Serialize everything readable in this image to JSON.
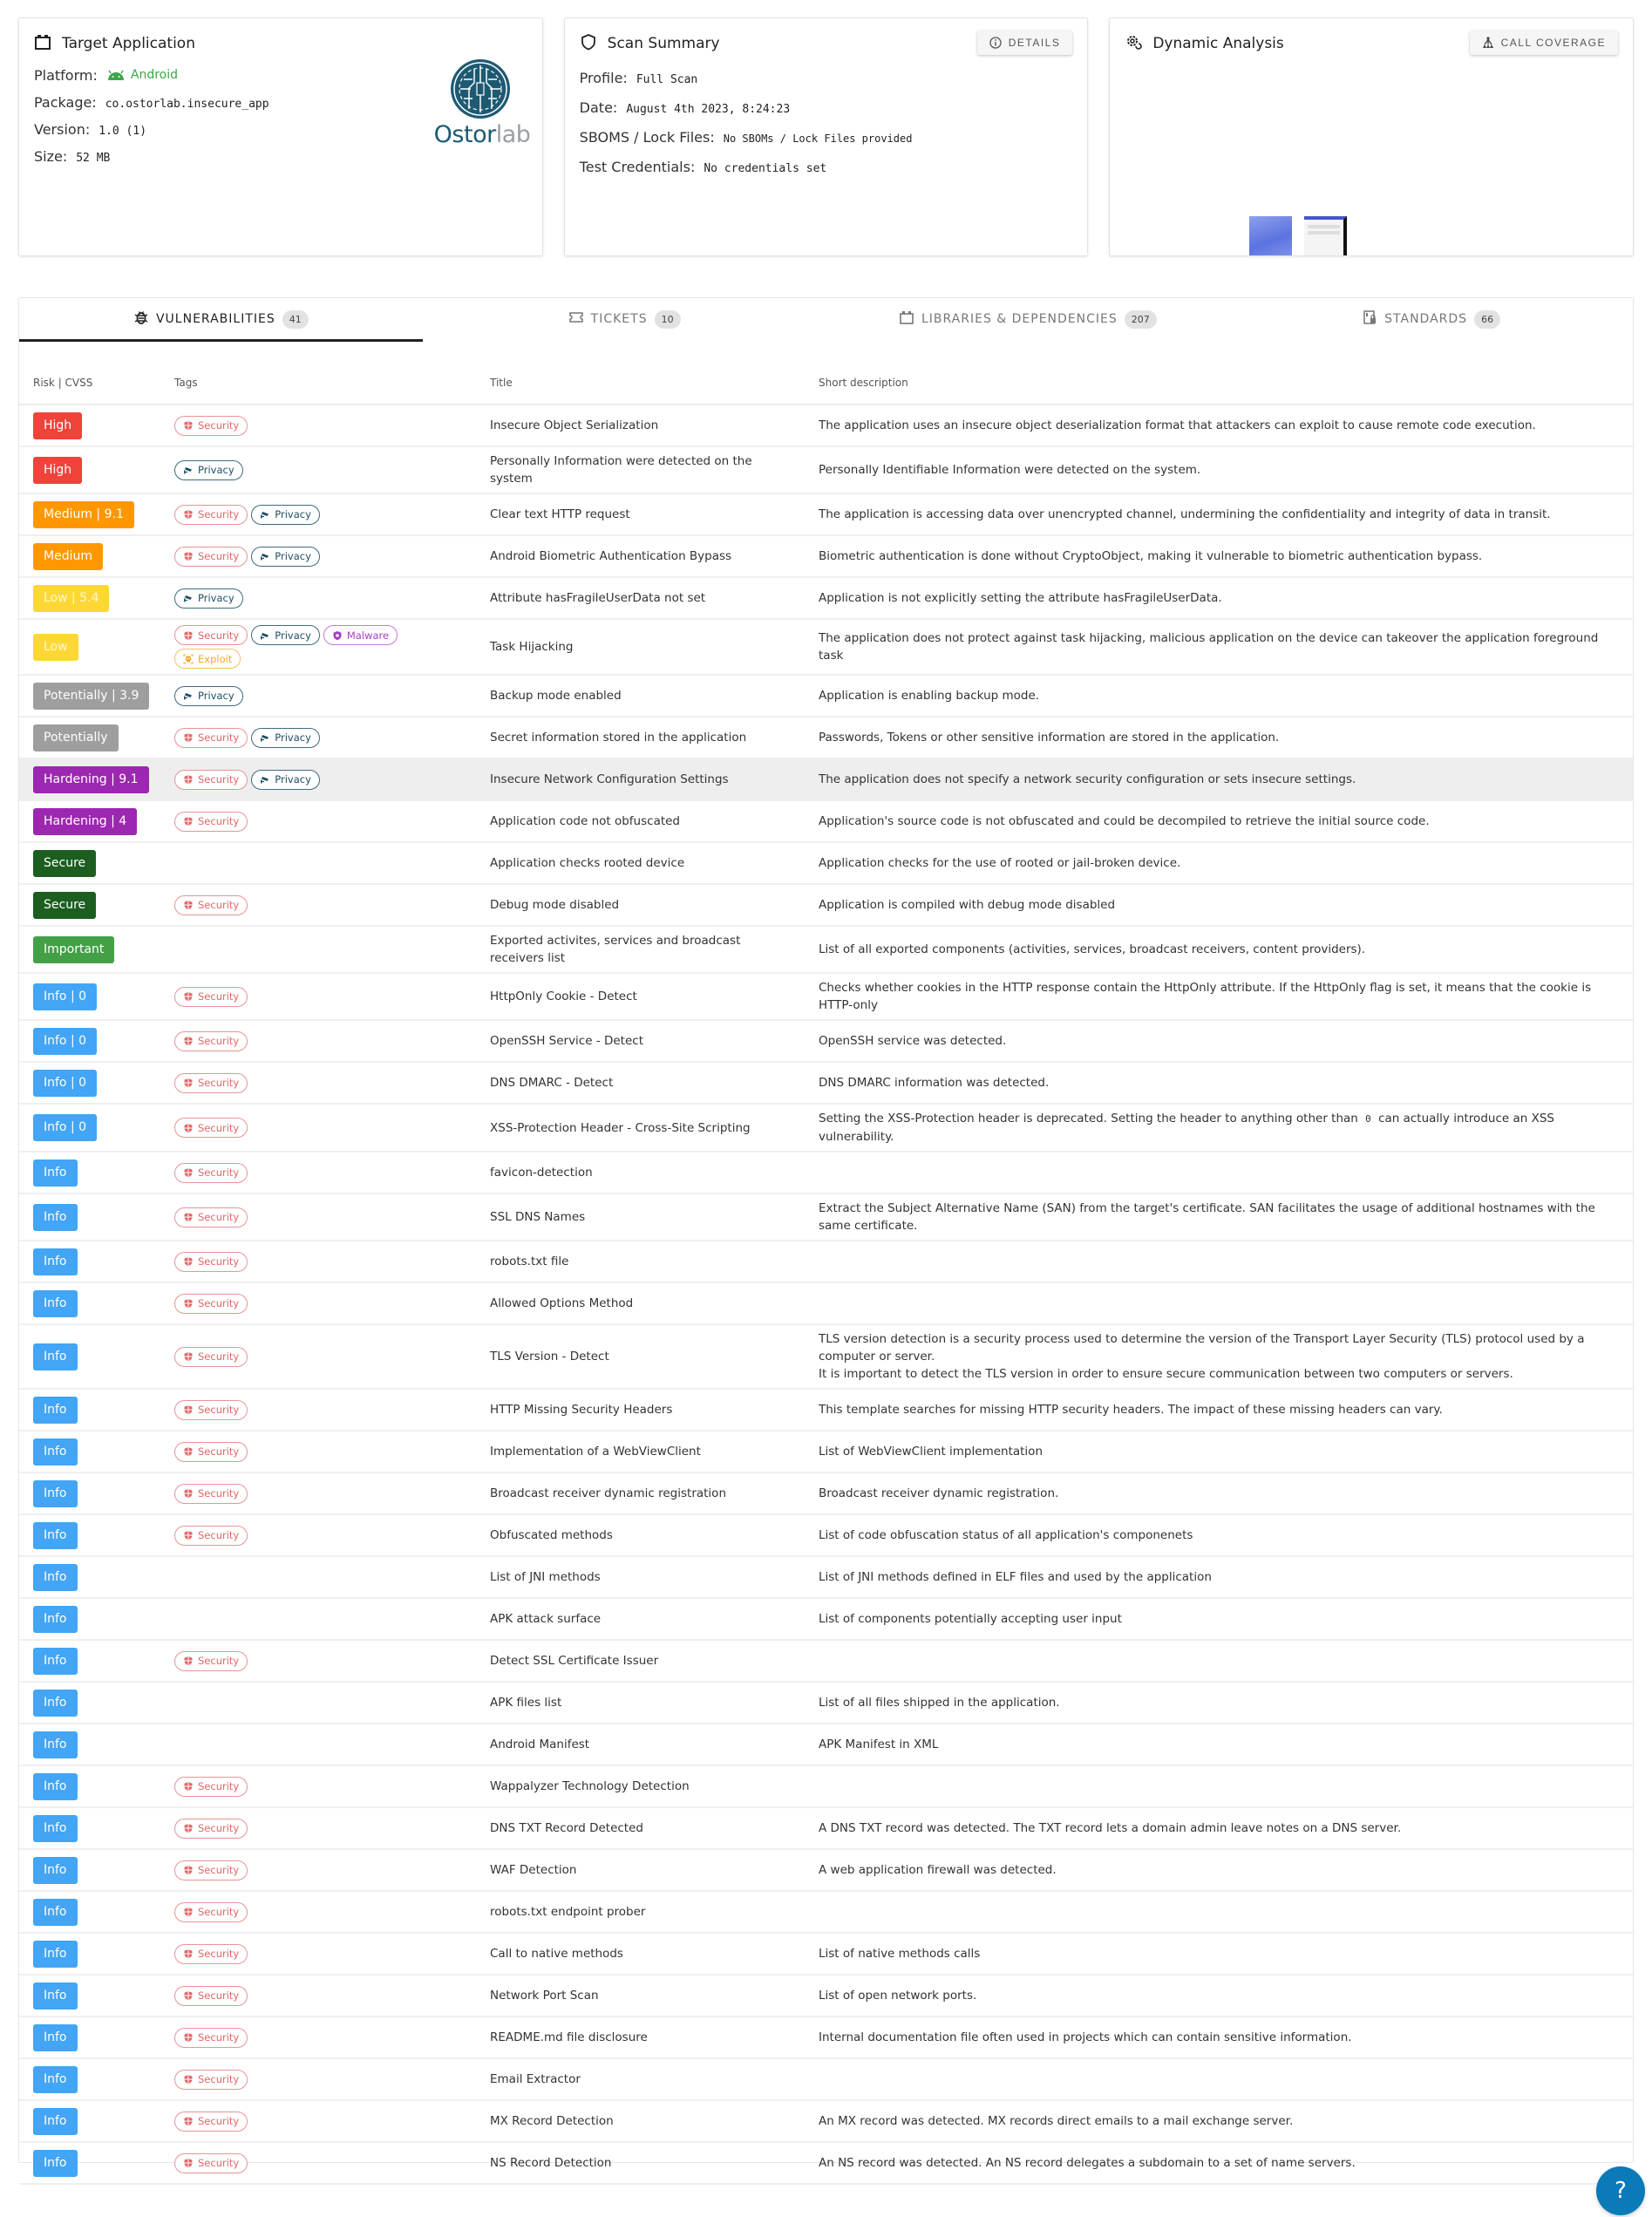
{
  "target_app": {
    "title": "Target Application",
    "platform_label": "Platform:",
    "platform_value": "Android",
    "package_label": "Package:",
    "package_value": "co.ostorlab.insecure_app",
    "version_label": "Version:",
    "version_value": "1.0 (1)",
    "size_label": "Size:",
    "size_value": "52 MB",
    "logo_text_main": "Ostor",
    "logo_text_light": "lab"
  },
  "scan_summary": {
    "title": "Scan Summary",
    "details_button": "DETAILS",
    "profile_label": "Profile:",
    "profile_value": "Full Scan",
    "date_label": "Date:",
    "date_value": "August 4th 2023, 8:24:23",
    "sboms_label": "SBOMS / Lock Files:",
    "sboms_value": "No SBOMs / Lock Files provided",
    "credentials_label": "Test Credentials:",
    "credentials_value": "No credentials set"
  },
  "dynamic_analysis": {
    "title": "Dynamic Analysis",
    "call_coverage_button": "CALL COVERAGE"
  },
  "tabs": [
    {
      "label": "VULNERABILITIES",
      "count": "41",
      "icon": "bug-icon",
      "active": true
    },
    {
      "label": "TICKETS",
      "count": "10",
      "icon": "ticket-icon",
      "active": false
    },
    {
      "label": "LIBRARIES & DEPENDENCIES",
      "count": "207",
      "icon": "package-icon",
      "active": false
    },
    {
      "label": "STANDARDS",
      "count": "66",
      "icon": "standards-lock-icon",
      "active": false
    }
  ],
  "table": {
    "headers": [
      "Risk | CVSS",
      "Tags",
      "Title",
      "Short description"
    ],
    "risk_colors": {
      "High": "#f0433a",
      "Medium": "#ff9800",
      "Low": "#fdd835",
      "Potentially": "#9e9e9e",
      "Hardening": "#9c27b0",
      "Secure": "#1b5e20",
      "Important": "#43a047",
      "Info": "#42a5f5"
    },
    "rows": [
      {
        "risk": "High",
        "cvss": "",
        "tags": [
          "Security"
        ],
        "title": "Insecure Object Serialization",
        "desc": "The application uses an insecure object deserialization format that attackers can exploit to cause remote code execution."
      },
      {
        "risk": "High",
        "cvss": "",
        "tags": [
          "Privacy"
        ],
        "title": "Personally Information were detected on the system",
        "desc": "Personally Identifiable Information were detected on the system."
      },
      {
        "risk": "Medium",
        "cvss": "9.1",
        "tags": [
          "Security",
          "Privacy"
        ],
        "title": "Clear text HTTP request",
        "desc": "The application is accessing data over unencrypted channel, undermining the confidentiality and integrity of data in transit."
      },
      {
        "risk": "Medium",
        "cvss": "",
        "tags": [
          "Security",
          "Privacy"
        ],
        "title": "Android Biometric Authentication Bypass",
        "desc": "Biometric authentication is done without CryptoObject, making it vulnerable to biometric authentication bypass."
      },
      {
        "risk": "Low",
        "cvss": "5.4",
        "tags": [
          "Privacy"
        ],
        "title": "Attribute hasFragileUserData not set",
        "desc": "Application is not explicitly setting the attribute hasFragileUserData."
      },
      {
        "risk": "Low",
        "cvss": "",
        "tags": [
          "Security",
          "Privacy",
          "Malware",
          "Exploit"
        ],
        "title": "Task Hijacking",
        "desc": "The application does not protect against task hijacking, malicious application on the device can takeover the application foreground task"
      },
      {
        "risk": "Potentially",
        "cvss": "3.9",
        "tags": [
          "Privacy"
        ],
        "title": "Backup mode enabled",
        "desc": "Application is enabling backup mode."
      },
      {
        "risk": "Potentially",
        "cvss": "",
        "tags": [
          "Security",
          "Privacy"
        ],
        "title": "Secret information stored in the application",
        "desc": "Passwords, Tokens or other sensitive information are stored in the application."
      },
      {
        "risk": "Hardening",
        "cvss": "9.1",
        "tags": [
          "Security",
          "Privacy"
        ],
        "title": "Insecure Network Configuration Settings",
        "desc": "The application does not specify a network security configuration or sets insecure settings.",
        "highlighted": true
      },
      {
        "risk": "Hardening",
        "cvss": "4",
        "tags": [
          "Security"
        ],
        "title": "Application code not obfuscated",
        "desc": "Application's source code is not obfuscated and could be decompiled to retrieve the initial source code."
      },
      {
        "risk": "Secure",
        "cvss": "",
        "tags": [],
        "title": "Application checks rooted device",
        "desc": "Application checks for the use of rooted or jail-broken device."
      },
      {
        "risk": "Secure",
        "cvss": "",
        "tags": [
          "Security"
        ],
        "title": "Debug mode disabled",
        "desc": "Application is compiled with debug mode disabled"
      },
      {
        "risk": "Important",
        "cvss": "",
        "tags": [],
        "title": "Exported activites, services and broadcast receivers list",
        "desc": "List of all exported components (activities, services, broadcast receivers, content providers)."
      },
      {
        "risk": "Info",
        "cvss": "0",
        "tags": [
          "Security"
        ],
        "title": "HttpOnly Cookie - Detect",
        "desc": "Checks whether cookies in the HTTP response contain the HttpOnly attribute. If the HttpOnly flag is set, it means that the cookie is HTTP-only"
      },
      {
        "risk": "Info",
        "cvss": "0",
        "tags": [
          "Security"
        ],
        "title": "OpenSSH Service - Detect",
        "desc": "OpenSSH service was detected."
      },
      {
        "risk": "Info",
        "cvss": "0",
        "tags": [
          "Security"
        ],
        "title": "DNS DMARC - Detect",
        "desc": "DNS DMARC information was detected."
      },
      {
        "risk": "Info",
        "cvss": "0",
        "tags": [
          "Security"
        ],
        "title": "XSS-Protection Header - Cross-Site Scripting",
        "desc": "Setting the XSS-Protection header is deprecated. Setting the header to anything other than",
        "desc_code": "0",
        "desc_after": "can actually introduce an XSS vulnerability."
      },
      {
        "risk": "Info",
        "cvss": "",
        "tags": [
          "Security"
        ],
        "title": "favicon-detection",
        "desc": ""
      },
      {
        "risk": "Info",
        "cvss": "",
        "tags": [
          "Security"
        ],
        "title": "SSL DNS Names",
        "desc": "Extract the Subject Alternative Name (SAN) from the target's certificate. SAN facilitates the usage of additional hostnames with the same certificate."
      },
      {
        "risk": "Info",
        "cvss": "",
        "tags": [
          "Security"
        ],
        "title": "robots.txt file",
        "desc": ""
      },
      {
        "risk": "Info",
        "cvss": "",
        "tags": [
          "Security"
        ],
        "title": "Allowed Options Method",
        "desc": ""
      },
      {
        "risk": "Info",
        "cvss": "",
        "tags": [
          "Security"
        ],
        "title": "TLS Version - Detect",
        "desc": "TLS version detection is a security process used to determine the version of the Transport Layer Security (TLS) protocol used by a computer or server.",
        "desc_line2": "It is important to detect the TLS version in order to ensure secure communication between two computers or servers."
      },
      {
        "risk": "Info",
        "cvss": "",
        "tags": [
          "Security"
        ],
        "title": "HTTP Missing Security Headers",
        "desc": "This template searches for missing HTTP security headers. The impact of these missing headers can vary."
      },
      {
        "risk": "Info",
        "cvss": "",
        "tags": [
          "Security"
        ],
        "title": "Implementation of a WebViewClient",
        "desc": "List of WebViewClient implementation"
      },
      {
        "risk": "Info",
        "cvss": "",
        "tags": [
          "Security"
        ],
        "title": "Broadcast receiver dynamic registration",
        "desc": "Broadcast receiver dynamic registration."
      },
      {
        "risk": "Info",
        "cvss": "",
        "tags": [
          "Security"
        ],
        "title": "Obfuscated methods",
        "desc": "List of code obfuscation status of all application's componenets"
      },
      {
        "risk": "Info",
        "cvss": "",
        "tags": [],
        "title": "List of JNI methods",
        "desc": "List of JNI methods defined in ELF files and used by the application"
      },
      {
        "risk": "Info",
        "cvss": "",
        "tags": [],
        "title": "APK attack surface",
        "desc": "List of components potentially accepting user input"
      },
      {
        "risk": "Info",
        "cvss": "",
        "tags": [
          "Security"
        ],
        "title": "Detect SSL Certificate Issuer",
        "desc": ""
      },
      {
        "risk": "Info",
        "cvss": "",
        "tags": [],
        "title": "APK files list",
        "desc": "List of all files shipped in the application."
      },
      {
        "risk": "Info",
        "cvss": "",
        "tags": [],
        "title": "Android Manifest",
        "desc": "APK Manifest in XML"
      },
      {
        "risk": "Info",
        "cvss": "",
        "tags": [
          "Security"
        ],
        "title": "Wappalyzer Technology Detection",
        "desc": ""
      },
      {
        "risk": "Info",
        "cvss": "",
        "tags": [
          "Security"
        ],
        "title": "DNS TXT Record Detected",
        "desc": "A DNS TXT record was detected. The TXT record lets a domain admin leave notes on a DNS server."
      },
      {
        "risk": "Info",
        "cvss": "",
        "tags": [
          "Security"
        ],
        "title": "WAF Detection",
        "desc": "A web application firewall was detected."
      },
      {
        "risk": "Info",
        "cvss": "",
        "tags": [
          "Security"
        ],
        "title": "robots.txt endpoint prober",
        "desc": ""
      },
      {
        "risk": "Info",
        "cvss": "",
        "tags": [
          "Security"
        ],
        "title": "Call to native methods",
        "desc": "List of native methods calls"
      },
      {
        "risk": "Info",
        "cvss": "",
        "tags": [
          "Security"
        ],
        "title": "Network Port Scan",
        "desc": "List of open network ports."
      },
      {
        "risk": "Info",
        "cvss": "",
        "tags": [
          "Security"
        ],
        "title": "README.md file disclosure",
        "desc": "Internal documentation file often used in projects which can contain sensitive information."
      },
      {
        "risk": "Info",
        "cvss": "",
        "tags": [
          "Security"
        ],
        "title": "Email Extractor",
        "desc": ""
      },
      {
        "risk": "Info",
        "cvss": "",
        "tags": [
          "Security"
        ],
        "title": "MX Record Detection",
        "desc": "An MX record was detected. MX records direct emails to a mail exchange server."
      },
      {
        "risk": "Info",
        "cvss": "",
        "tags": [
          "Security"
        ],
        "title": "NS Record Detection",
        "desc": "An NS record was detected. An NS record delegates a subdomain to a set of name servers."
      }
    ]
  },
  "help_button": "?"
}
